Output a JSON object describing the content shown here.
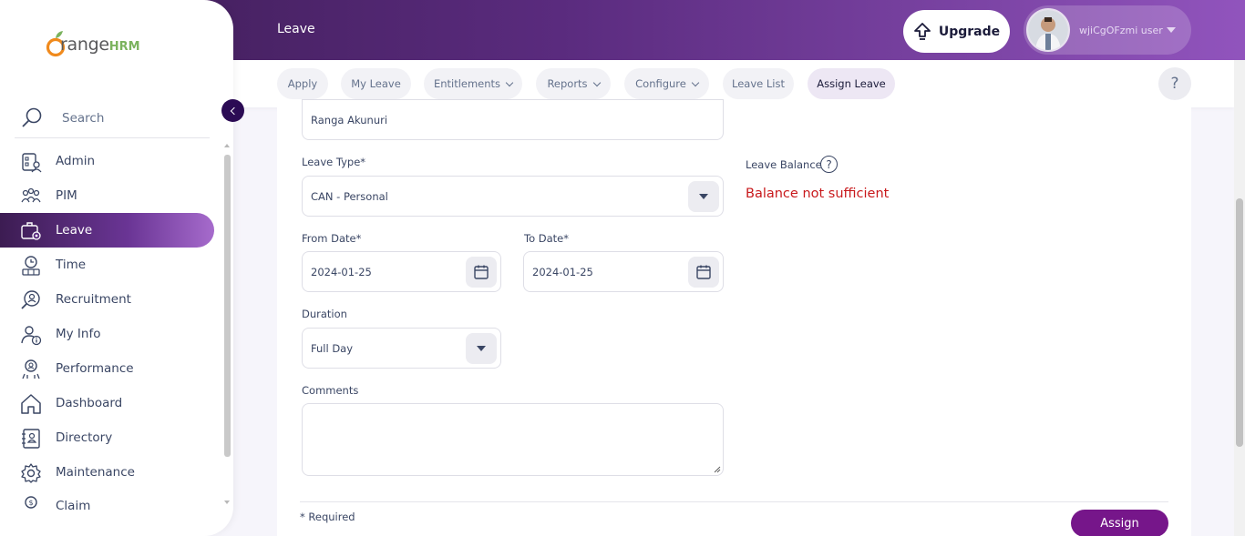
{
  "header": {
    "title": "Leave",
    "upgrade_label": "Upgrade",
    "user_name": "wjiCgOFzmi user"
  },
  "subnav": {
    "tabs": [
      {
        "label": "Apply",
        "has_menu": false,
        "active": false
      },
      {
        "label": "My Leave",
        "has_menu": false,
        "active": false
      },
      {
        "label": "Entitlements",
        "has_menu": true,
        "active": false
      },
      {
        "label": "Reports",
        "has_menu": true,
        "active": false
      },
      {
        "label": "Configure",
        "has_menu": true,
        "active": false
      },
      {
        "label": "Leave List",
        "has_menu": false,
        "active": false
      },
      {
        "label": "Assign Leave",
        "has_menu": false,
        "active": true
      }
    ],
    "help_label": "?"
  },
  "sidebar": {
    "logo_text": "range",
    "logo_suffix": "HRM",
    "search_label": "Search",
    "items": [
      {
        "label": "Admin",
        "icon": "admin-icon"
      },
      {
        "label": "PIM",
        "icon": "pim-icon"
      },
      {
        "label": "Leave",
        "icon": "leave-icon",
        "active": true
      },
      {
        "label": "Time",
        "icon": "time-icon"
      },
      {
        "label": "Recruitment",
        "icon": "recruitment-icon"
      },
      {
        "label": "My Info",
        "icon": "my-info-icon"
      },
      {
        "label": "Performance",
        "icon": "performance-icon"
      },
      {
        "label": "Dashboard",
        "icon": "dashboard-icon"
      },
      {
        "label": "Directory",
        "icon": "directory-icon"
      },
      {
        "label": "Maintenance",
        "icon": "maintenance-icon"
      },
      {
        "label": "Claim",
        "icon": "claim-icon"
      }
    ]
  },
  "form": {
    "employee_value": "Ranga  Akunuri",
    "leave_type_label": "Leave Type*",
    "leave_type_value": "CAN - Personal",
    "leave_balance_label": "Leave Balance",
    "leave_balance_help": "?",
    "balance_message": "Balance not sufficient",
    "from_date_label": "From Date*",
    "from_date_value": "2024-01-25",
    "to_date_label": "To Date*",
    "to_date_value": "2024-01-25",
    "duration_label": "Duration",
    "duration_value": "Full Day",
    "comments_label": "Comments",
    "comments_value": "",
    "required_note": "* Required",
    "assign_label": "Assign"
  },
  "colors": {
    "brand_purple": "#76168a",
    "header_start": "#3c1c52",
    "header_end": "#9154bd",
    "error_red": "#c8191c"
  }
}
